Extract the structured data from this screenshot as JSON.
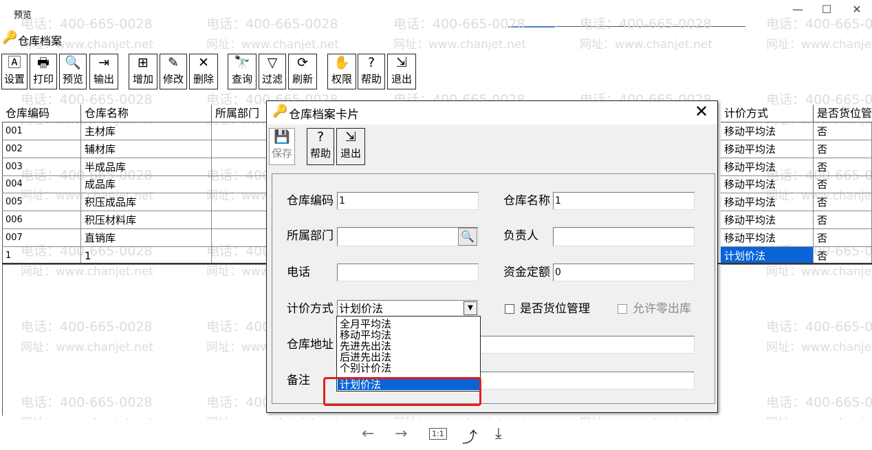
{
  "window": {
    "title": "预览",
    "minimize": "—",
    "maximize": "☐",
    "close": "✕"
  },
  "app": {
    "title": "仓库档案",
    "icon": "key-icon"
  },
  "toolbar": [
    {
      "label": "设置",
      "icon": "settings-icon",
      "glyph": "🄰"
    },
    {
      "label": "打印",
      "icon": "printer-icon",
      "glyph": "🖶"
    },
    {
      "label": "预览",
      "icon": "preview-icon",
      "glyph": "🔍"
    },
    {
      "label": "输出",
      "icon": "export-icon",
      "glyph": "⇥"
    },
    {
      "label": "增加",
      "icon": "add-icon",
      "glyph": "⊞"
    },
    {
      "label": "修改",
      "icon": "edit-icon",
      "glyph": "✎"
    },
    {
      "label": "删除",
      "icon": "delete-icon",
      "glyph": "✕"
    },
    {
      "label": "查询",
      "icon": "binoculars-icon",
      "glyph": "🔭"
    },
    {
      "label": "过滤",
      "icon": "filter-icon",
      "glyph": "▽"
    },
    {
      "label": "刷新",
      "icon": "refresh-icon",
      "glyph": "⟳"
    },
    {
      "label": "权限",
      "icon": "permission-icon",
      "glyph": "✋"
    },
    {
      "label": "帮助",
      "icon": "help-icon",
      "glyph": "?"
    },
    {
      "label": "退出",
      "icon": "exit-icon",
      "glyph": "⇲"
    }
  ],
  "grid": {
    "headers": [
      "仓库编码",
      "仓库名称",
      "所属部门",
      "计价方式",
      "是否货位管"
    ],
    "rows": [
      {
        "code": "001",
        "name": "主材库",
        "method": "移动平均法",
        "loc": "否"
      },
      {
        "code": "002",
        "name": "辅材库",
        "method": "移动平均法",
        "loc": "否"
      },
      {
        "code": "003",
        "name": "半成品库",
        "method": "移动平均法",
        "loc": "否"
      },
      {
        "code": "004",
        "name": "成品库",
        "method": "移动平均法",
        "loc": "否"
      },
      {
        "code": "005",
        "name": "积压成品库",
        "method": "移动平均法",
        "loc": "否"
      },
      {
        "code": "006",
        "name": "积压材料库",
        "method": "移动平均法",
        "loc": "否"
      },
      {
        "code": "007",
        "name": "直销库",
        "method": "移动平均法",
        "loc": "否"
      },
      {
        "code": "1",
        "name": "1",
        "method": "计划价法",
        "loc": "否"
      }
    ],
    "selected_color": "#0a64d8"
  },
  "dialog": {
    "title": "仓库档案卡片",
    "close": "✕",
    "toolbar": [
      {
        "label": "保存",
        "icon": "save-icon",
        "glyph": "💾",
        "disabled": true
      },
      {
        "label": "帮助",
        "icon": "help-icon",
        "glyph": "?"
      },
      {
        "label": "退出",
        "icon": "exit-icon",
        "glyph": "⇲"
      }
    ],
    "fields": {
      "code_label": "仓库编码",
      "code_value": "1",
      "name_label": "仓库名称",
      "name_value": "1",
      "dept_label": "所属部门",
      "dept_value": "",
      "manager_label": "负责人",
      "manager_value": "",
      "phone_label": "电话",
      "phone_value": "",
      "fund_label": "资金定额",
      "fund_value": "0",
      "method_label": "计价方式",
      "method_value": "计划价法",
      "location_label": "是否货位管理",
      "zero_out_label": "允许零出库",
      "address_label": "仓库地址",
      "address_value": "",
      "remark_label": "备注",
      "remark_value": ""
    },
    "method_options": [
      "全月平均法",
      "移动平均法",
      "先进先出法",
      "后进先出法",
      "个别计价法",
      "计划价法"
    ],
    "selected_option_index": 5
  },
  "watermark": {
    "phone": "电话：400-665-0028",
    "url": "网址：www.chanjet.net"
  },
  "bottom_nav": {
    "back": "←",
    "forward": "→",
    "actual_size": "1:1",
    "rotate": "⤴",
    "download": "⤓"
  },
  "accent_color": "#e02020"
}
